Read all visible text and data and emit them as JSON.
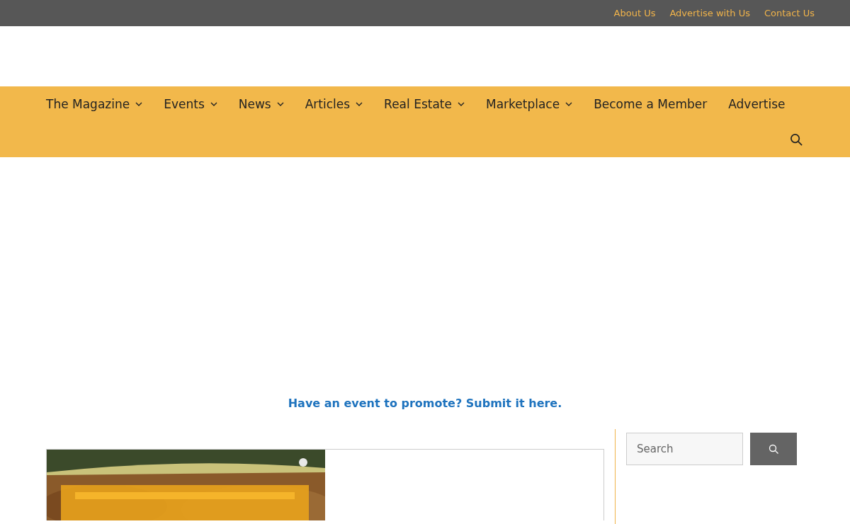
{
  "top_bar": {
    "links": [
      "About Us",
      "Advertise with Us",
      "Contact Us"
    ]
  },
  "nav": {
    "items": [
      {
        "label": "The Magazine",
        "kind": "dropdown"
      },
      {
        "label": "Events",
        "kind": "dropdown"
      },
      {
        "label": "News",
        "kind": "dropdown"
      },
      {
        "label": "Articles",
        "kind": "dropdown"
      },
      {
        "label": "Real Estate",
        "kind": "dropdown"
      },
      {
        "label": "Marketplace",
        "kind": "dropdown"
      },
      {
        "label": "Become a Member",
        "kind": "link"
      },
      {
        "label": "Advertise",
        "kind": "link"
      }
    ]
  },
  "promo_link": "Have an event to promote? Submit it here.",
  "sidebar": {
    "search": {
      "placeholder": "Search"
    }
  }
}
